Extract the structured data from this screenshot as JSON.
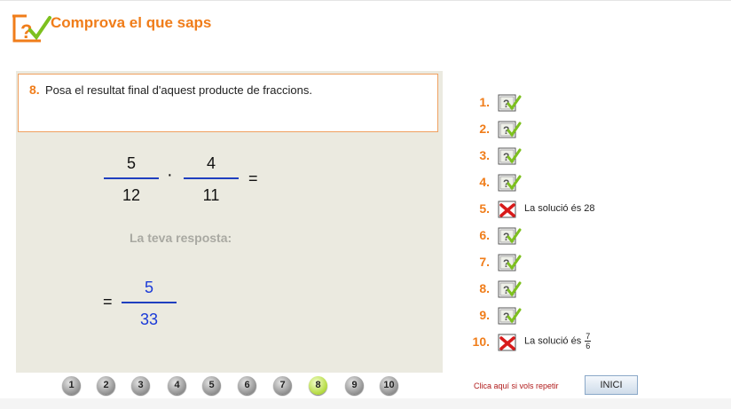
{
  "header": {
    "title": "Comprova el que saps",
    "logo_icon": "question-check-icon"
  },
  "question": {
    "number": "8.",
    "text": "Posa el resultat final d'aquest producte de fraccions.",
    "frac1": {
      "num": "5",
      "den": "12"
    },
    "operator": "·",
    "frac2": {
      "num": "4",
      "den": "11"
    },
    "equals": "="
  },
  "answer": {
    "label": "La teva resposta:",
    "equals": "=",
    "num": "5",
    "den": "33"
  },
  "nav": {
    "buttons": [
      "1",
      "2",
      "3",
      "4",
      "5",
      "6",
      "7",
      "8",
      "9",
      "10"
    ],
    "active": "8"
  },
  "results": [
    {
      "n": "1.",
      "status": "correct",
      "icon": "check-icon"
    },
    {
      "n": "2.",
      "status": "correct",
      "icon": "check-icon"
    },
    {
      "n": "3.",
      "status": "correct",
      "icon": "check-icon"
    },
    {
      "n": "4.",
      "status": "correct",
      "icon": "check-icon"
    },
    {
      "n": "5.",
      "status": "wrong",
      "icon": "cross-icon",
      "solution": "La solució és 28"
    },
    {
      "n": "6.",
      "status": "correct",
      "icon": "check-icon"
    },
    {
      "n": "7.",
      "status": "correct",
      "icon": "check-icon"
    },
    {
      "n": "8.",
      "status": "correct",
      "icon": "check-icon"
    },
    {
      "n": "9.",
      "status": "correct",
      "icon": "check-icon"
    },
    {
      "n": "10.",
      "status": "wrong",
      "icon": "cross-icon",
      "solution": "La solució és",
      "sol_num": "7",
      "sol_den": "6"
    }
  ],
  "footer": {
    "repeat_text": "Clica aquí si vols repetir",
    "start_button": "INICI"
  },
  "colors": {
    "accent": "#f07d1a",
    "answer": "#1a3ad8",
    "panel": "#ebeae0",
    "check": "#7dc01e",
    "cross": "#d81a1a"
  }
}
